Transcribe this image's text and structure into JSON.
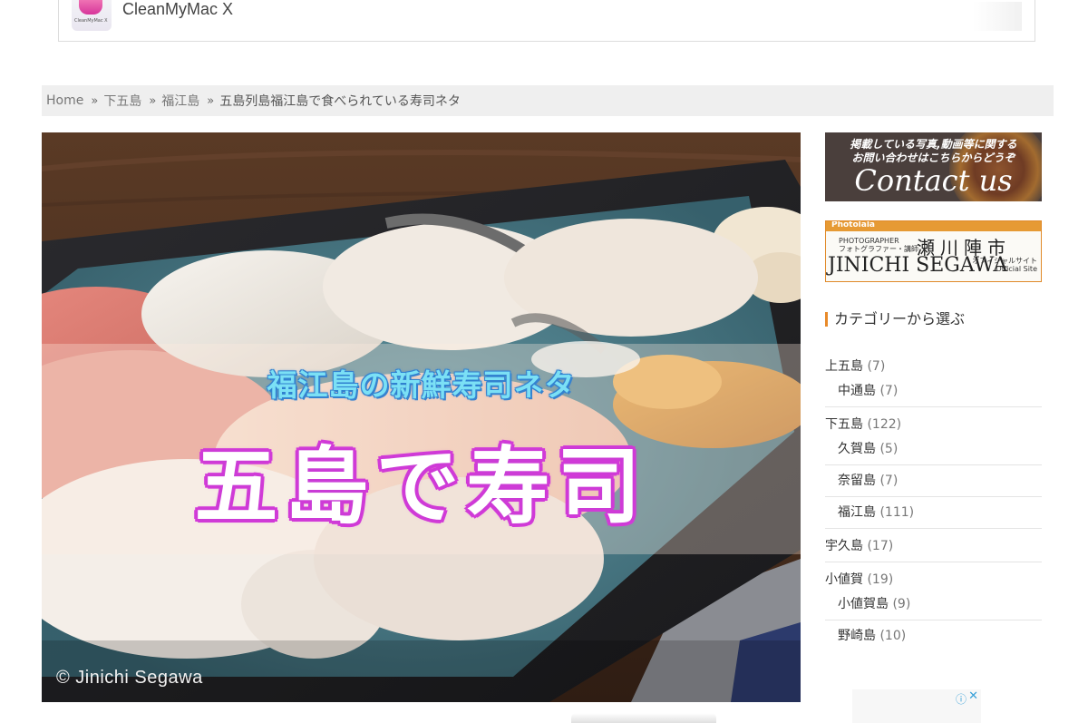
{
  "ad": {
    "app_name": "CleanMyMac X",
    "icon_caption": "CleanMyMac X"
  },
  "breadcrumb": {
    "items": [
      {
        "label": "Home"
      },
      {
        "label": "下五島"
      },
      {
        "label": "福江島"
      }
    ],
    "current": "五島列島福江島で食べられている寿司ネタ",
    "separator": "»"
  },
  "hero": {
    "subtitle": "福江島の新鮮寿司ネタ",
    "title": "五島で寿司",
    "credit": "© Jinichi Segawa"
  },
  "sidebar": {
    "contact_banner": {
      "line1": "掲載している写真,動画等に関する",
      "line2": "お問い合わせはこちらからどうぞ",
      "big": "Contact us"
    },
    "photographer_banner": {
      "brand": "Photolala",
      "role_line1": "PHOTOGRAPHER",
      "role_line2": "フォトグラファー・講師",
      "name_jp": "瀬川陣市",
      "name_en": "JINICHI SEGAWA",
      "site_line1": "オフィシャルサイト",
      "site_line2": "Official Site"
    },
    "categories_heading": "カテゴリーから選ぶ",
    "categories": [
      {
        "name": "上五島",
        "count": "(7)",
        "children": [
          {
            "name": "中通島",
            "count": "(7)"
          }
        ]
      },
      {
        "name": "下五島",
        "count": "(122)",
        "children": [
          {
            "name": "久賀島",
            "count": "(5)"
          },
          {
            "name": "奈留島",
            "count": "(7)"
          },
          {
            "name": "福江島",
            "count": "(111)"
          }
        ]
      },
      {
        "name": "宇久島",
        "count": "(17)",
        "children": []
      },
      {
        "name": "小値賀",
        "count": "(19)",
        "children": [
          {
            "name": "小値賀島",
            "count": "(9)"
          },
          {
            "name": "野崎島",
            "count": "(10)"
          }
        ]
      }
    ]
  },
  "adchip": {
    "info_icon": "ⓘ",
    "close_icon": "✕"
  },
  "colors": {
    "accent_orange": "#e88a2a",
    "title_magenta": "#d43ad8",
    "subtitle_cyan": "#7be0f5",
    "breadcrumb_bg": "#efefef"
  }
}
